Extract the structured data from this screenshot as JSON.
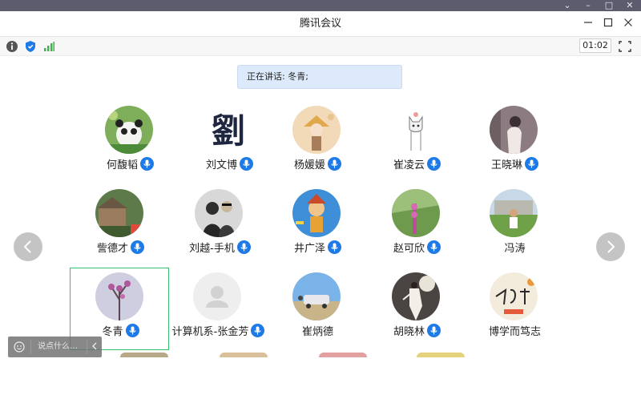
{
  "window": {
    "title": "腾讯会议",
    "outer_controls": [
      "⌄",
      "–",
      "□",
      "✕"
    ]
  },
  "toolbar": {
    "timer": "01:02"
  },
  "speaking": {
    "text": "正在讲话: 冬青;"
  },
  "participants": [
    {
      "name": "何馥韬",
      "mic": true
    },
    {
      "name": "刘文博",
      "mic": true
    },
    {
      "name": "杨媛媛",
      "mic": true
    },
    {
      "name": "崔凌云",
      "mic": true
    },
    {
      "name": "王晓琳",
      "mic": true
    },
    {
      "name": "訾德才",
      "mic": true
    },
    {
      "name": "刘越-手机",
      "mic": true
    },
    {
      "name": "井广泽",
      "mic": true
    },
    {
      "name": "赵可欣",
      "mic": true
    },
    {
      "name": "冯涛",
      "mic": false
    },
    {
      "name": "冬青",
      "mic": true
    },
    {
      "name": "计算机系-张金芳",
      "mic": true
    },
    {
      "name": "崔炳德",
      "mic": false
    },
    {
      "name": "胡晓林",
      "mic": true
    },
    {
      "name": "博学而笃志",
      "mic": false
    }
  ],
  "avatar_texts": {
    "liu_calligraphy": "劉"
  },
  "chat": {
    "placeholder": "说点什么…"
  },
  "colors": {
    "accent": "#1e7ae6",
    "active_speaker_border": "#35c06a",
    "speaking_bg": "#dceafb"
  }
}
